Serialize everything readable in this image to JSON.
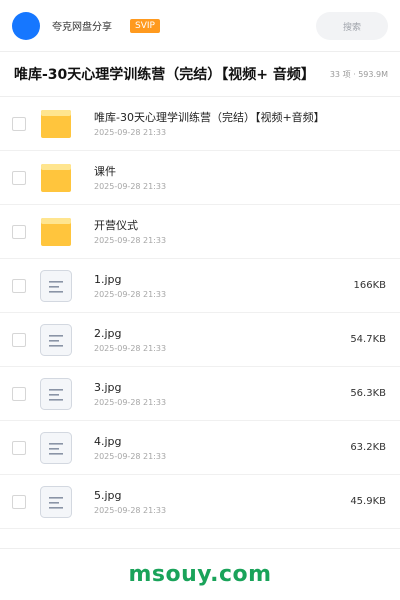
{
  "header": {
    "brand": "夸克网盘分享",
    "badge": "SVIP",
    "search_label": "搜索"
  },
  "titlebar": {
    "title": "唯库-30天心理学训练营（完结）【视频+ 音频】",
    "meta": "33 项 · 593.9M"
  },
  "files": [
    {
      "type": "folder",
      "icon": "folder-icon",
      "name": "唯库-30天心理学训练营（完结）【视频+音频】",
      "time": "2025-09-28 21:33",
      "size": ""
    },
    {
      "type": "folder",
      "icon": "folder-icon",
      "name": "课件",
      "time": "2025-09-28 21:33",
      "size": ""
    },
    {
      "type": "folder",
      "icon": "folder-icon",
      "name": "开营仪式",
      "time": "2025-09-28 21:33",
      "size": ""
    },
    {
      "type": "file",
      "icon": "file-document-icon",
      "name": "1.jpg",
      "time": "2025-09-28 21:33",
      "size": "166KB"
    },
    {
      "type": "file",
      "icon": "file-document-icon",
      "name": "2.jpg",
      "time": "2025-09-28 21:33",
      "size": "54.7KB"
    },
    {
      "type": "file",
      "icon": "file-document-icon",
      "name": "3.jpg",
      "time": "2025-09-28 21:33",
      "size": "56.3KB"
    },
    {
      "type": "file",
      "icon": "file-document-icon",
      "name": "4.jpg",
      "time": "2025-09-28 21:33",
      "size": "63.2KB"
    },
    {
      "type": "file",
      "icon": "file-document-icon",
      "name": "5.jpg",
      "time": "2025-09-28 21:33",
      "size": "45.9KB"
    }
  ],
  "footer": {
    "watermark": "msouy.com"
  },
  "colors": {
    "accent": "#1677ff",
    "badge": "#ff9a1f",
    "folder": "#ffc53d",
    "watermark": "#1aa35a"
  }
}
